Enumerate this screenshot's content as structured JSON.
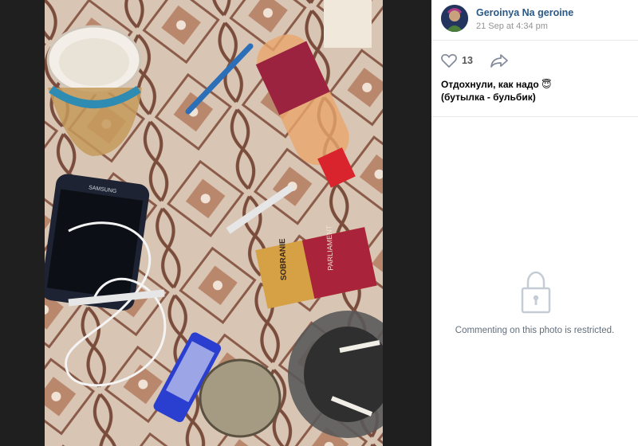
{
  "author": {
    "name": "Geroinya Na geroine",
    "date": "21 Sep at 4:34 pm"
  },
  "post": {
    "like_count": "13",
    "caption_line1": "Отдохнули, как надо 😇",
    "caption_line2": "(бутылка - бульбик)"
  },
  "comments": {
    "restricted_message": "Commenting on this photo is restricted."
  },
  "photo": {
    "phone_brand": "SAMSUNG",
    "cigarette_brand": "SOBRANIE",
    "pack_text": "PARLIAMENT"
  },
  "icons": {
    "like": "heart-icon",
    "share": "share-arrow-icon",
    "lock": "lock-icon"
  },
  "colors": {
    "link": "#2a5885",
    "muted": "#939393",
    "divider": "#e7e8ec",
    "background_dark": "#1f1f1f"
  }
}
